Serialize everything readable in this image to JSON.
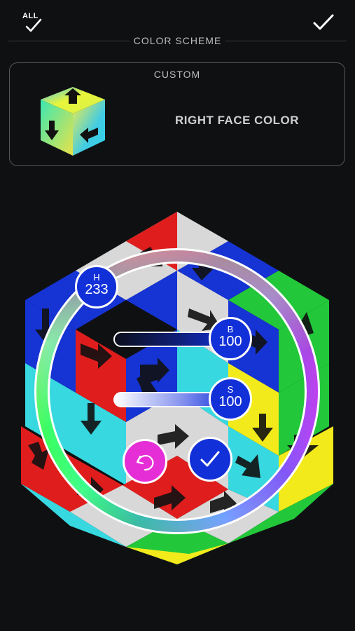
{
  "header": {
    "all_label": "ALL",
    "section_title": "COLOR SCHEME"
  },
  "scheme": {
    "name": "CUSTOM",
    "face_label": "RIGHT FACE COLOR"
  },
  "picker": {
    "hue": {
      "label": "H",
      "value": "233"
    },
    "brightness": {
      "label": "B",
      "value": "100"
    },
    "saturation": {
      "label": "S",
      "value": "100"
    }
  },
  "colors": {
    "background": "#0f1012",
    "knob": "#1230d8",
    "undo_button": "#e62ed6",
    "confirm_button": "#1230d8"
  },
  "icons": {
    "all": "check-all-icon",
    "done": "check-icon",
    "undo": "undo-icon",
    "confirm": "check-icon"
  }
}
